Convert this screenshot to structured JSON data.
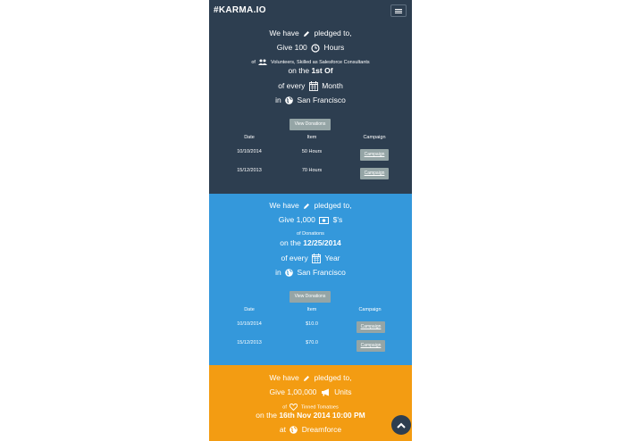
{
  "navbar": {
    "brand": "#KARMA.IO"
  },
  "pledges": [
    {
      "lead": "We have",
      "pledged": "pledged to,",
      "give": "Give 100",
      "unit": "Hours",
      "of_prefix": "of",
      "detail": "Volunteers, Skilled as Salesforce Consultants",
      "on_prefix": "on the",
      "on_value": "1st Of",
      "every_prefix": "of every",
      "every_value": "Month",
      "in_prefix": "in",
      "location": "San Francisco",
      "view_label": "View Donations",
      "headers": [
        "Date",
        "Item",
        "Campaign"
      ],
      "rows": [
        {
          "date": "10/10/2014",
          "item": "50 Hours",
          "campaign": "Campaign"
        },
        {
          "date": "15/12/2013",
          "item": "70 Hours",
          "campaign": "Campaign"
        }
      ]
    },
    {
      "lead": "We have",
      "pledged": "pledged to,",
      "give": "Give 1,000",
      "unit": "$'s",
      "detail": "of Donations",
      "on_prefix": "on the",
      "on_value": "12/25/2014",
      "every_prefix": "of every",
      "every_value": "Year",
      "in_prefix": "in",
      "location": "San Francisco",
      "view_label": "View Donations",
      "headers": [
        "Date",
        "Item",
        "Campaign"
      ],
      "rows": [
        {
          "date": "10/10/2014",
          "item": "$10.0",
          "campaign": "Campaign"
        },
        {
          "date": "15/12/2013",
          "item": "$70.0",
          "campaign": "Campaign"
        }
      ]
    },
    {
      "lead": "We have",
      "pledged": "pledged to,",
      "give": "Give 1,00,000",
      "unit": "Units",
      "of_prefix": "of",
      "detail": "Tinned Tomatoes",
      "on_prefix": "on the",
      "on_value": "16th Nov 2014 10:00 PM",
      "in_prefix": "at",
      "location": "Dreamforce"
    }
  ],
  "colors": {
    "navy": "#2d3e50",
    "blue": "#3498db",
    "orange": "#f39c12",
    "button": "#95a5a6"
  }
}
